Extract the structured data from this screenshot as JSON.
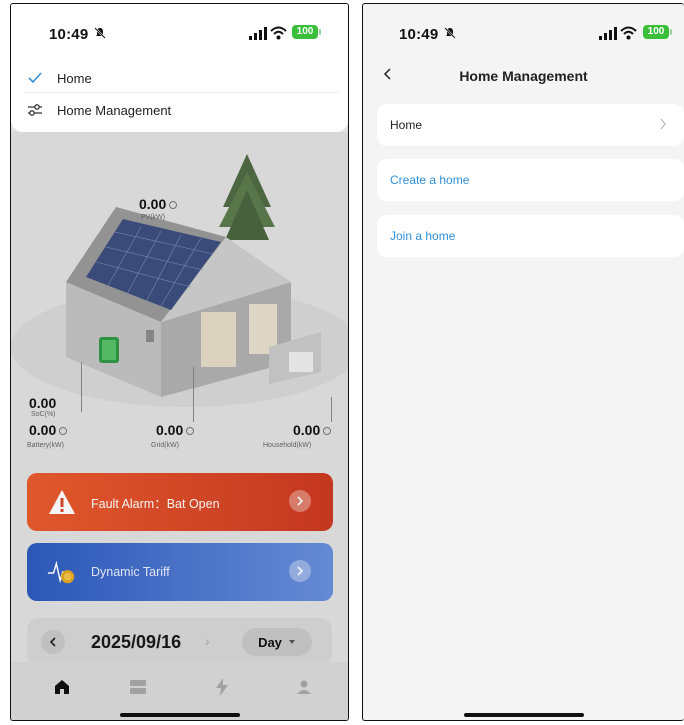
{
  "status_bar": {
    "time": "10:49",
    "battery": "100"
  },
  "left_screen": {
    "dropdown": {
      "items": [
        {
          "label": "Home",
          "selected": true
        },
        {
          "label": "Home Management",
          "selected": false
        }
      ]
    },
    "energy": {
      "pv": {
        "value": "0.00",
        "label": "PV(kW)"
      },
      "soc": {
        "value": "0.00",
        "label": "SoC(%)"
      },
      "battery": {
        "value": "0.00",
        "label": "Battery(kW)"
      },
      "grid": {
        "value": "0.00",
        "label": "Grid(kW)"
      },
      "household": {
        "value": "0.00",
        "label": "Household(kW)"
      }
    },
    "fault_card": {
      "text": "Fault Alarm：Bat Open"
    },
    "tariff_card": {
      "text": "Dynamic Tariff"
    },
    "date_bar": {
      "date": "2025/09/16",
      "period": "Day"
    },
    "tabs": [
      "home-tab",
      "devices-tab",
      "energy-tab",
      "profile-tab"
    ]
  },
  "right_screen": {
    "title": "Home Management",
    "rows": [
      {
        "label": "Home"
      },
      {
        "label": "Create a home"
      },
      {
        "label": "Join a home"
      }
    ]
  },
  "colors": {
    "accent_blue": "#2f8fd8",
    "fault_red": "#e04a2a",
    "tariff_blue": "#3b66c6",
    "battery_green": "#3bbf3b"
  }
}
